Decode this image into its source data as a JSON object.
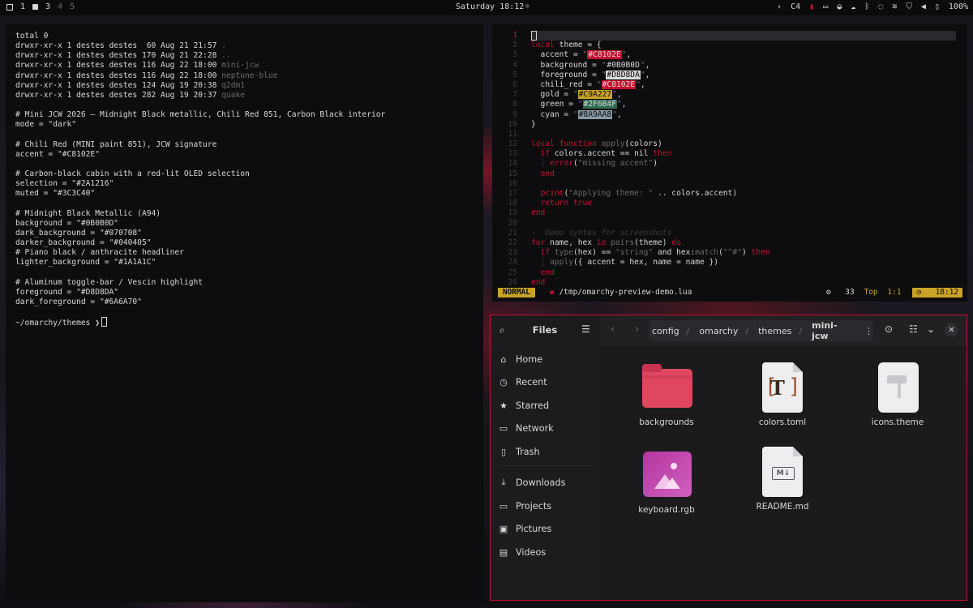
{
  "topbar": {
    "workspaces": [
      {
        "label": "1",
        "active": true
      },
      {
        "label": "3",
        "active": false
      },
      {
        "label": "4",
        "active": false
      },
      {
        "label": "5",
        "active": false
      }
    ],
    "clock": "Saturday 18:12",
    "weather_icon": "sun-icon",
    "tray": {
      "c4": "C4",
      "battery": "100%"
    }
  },
  "terminal": {
    "lines": [
      "total 0",
      "drwxr-xr-x 1 destes destes  60 Aug 21 21:57 .",
      "drwxr-xr-x 1 destes destes 170 Aug 21 22:28 ..",
      "drwxr-xr-x 1 destes destes 116 Aug 22 18:00 mini-jcw",
      "drwxr-xr-x 1 destes destes 116 Aug 22 18:00 neptune-blue",
      "drwxr-xr-x 1 destes destes 124 Aug 19 20:38 q2dm1",
      "drwxr-xr-x 1 destes destes 282 Aug 19 20:37 quake",
      "",
      "# Mini JCW 2026 — Midnight Black metallic, Chili Red 851, Carbon Black interior",
      "mode = \"dark\"",
      "",
      "# Chili Red (MINI paint 851), JCW signature",
      "accent = \"#C8102E\"",
      "",
      "# Carbon-black cabin with a red-lit OLED selection",
      "selection = \"#2A1216\"",
      "muted = \"#3C3C40\"",
      "",
      "# Midnight Black Metallic (A94)",
      "background = \"#0B0B0D\"",
      "dark_background = \"#070708\"",
      "darker_background = \"#040405\"",
      "# Piano black / anthracite headliner",
      "lighter_background = \"#1A1A1C\"",
      "",
      "# Aluminum toggle-bar / Vescin highlight",
      "foreground = \"#D8D8DA\"",
      "dark_foreground = \"#6A6A70\"",
      ""
    ],
    "prompt": "~/omarchy/themes ❯"
  },
  "editor": {
    "swatches": {
      "accent": "#C8102E",
      "background": "#0B0B0D",
      "foreground": "#D8D8DA",
      "chili_red": "#C8102E",
      "gold": "#C9A227",
      "green": "#2F6B4F",
      "cyan": "#8A9AA8"
    },
    "line_numbers": [
      "1",
      "2",
      "3",
      "4",
      "5",
      "6",
      "7",
      "8",
      "9",
      "10",
      "11",
      "12",
      "13",
      "14",
      "15",
      "16",
      "17",
      "18",
      "19",
      "20",
      "21",
      "22",
      "23",
      "24",
      "25",
      "26"
    ],
    "status": {
      "mode": "NORMAL",
      "path": "/tmp/omarchy-preview-demo.lua",
      "count": "33",
      "position": "Top",
      "cursor": "1:1",
      "time": "18:12"
    }
  },
  "files": {
    "title": "Files",
    "sidebar": [
      {
        "label": "Home",
        "icon": "home-icon",
        "glyph": "⌂"
      },
      {
        "label": "Recent",
        "icon": "clock-icon",
        "glyph": "◷"
      },
      {
        "label": "Starred",
        "icon": "star-icon",
        "glyph": "★"
      },
      {
        "label": "Network",
        "icon": "network-icon",
        "glyph": "▭"
      },
      {
        "label": "Trash",
        "icon": "trash-icon",
        "glyph": "▯"
      },
      {
        "label": "Downloads",
        "icon": "download-icon",
        "glyph": "⤓"
      },
      {
        "label": "Projects",
        "icon": "folder-icon",
        "glyph": "▭"
      },
      {
        "label": "Pictures",
        "icon": "picture-icon",
        "glyph": "▣"
      },
      {
        "label": "Videos",
        "icon": "video-icon",
        "glyph": "▤"
      }
    ],
    "breadcrumbs": [
      "config",
      "omarchy",
      "themes",
      "mini-jcw"
    ],
    "items": [
      {
        "name": "backgrounds",
        "type": "folder"
      },
      {
        "name": "colors.toml",
        "type": "text"
      },
      {
        "name": "icons.theme",
        "type": "theme"
      },
      {
        "name": "keyboard.rgb",
        "type": "image"
      },
      {
        "name": "README.md",
        "type": "markdown"
      }
    ]
  }
}
